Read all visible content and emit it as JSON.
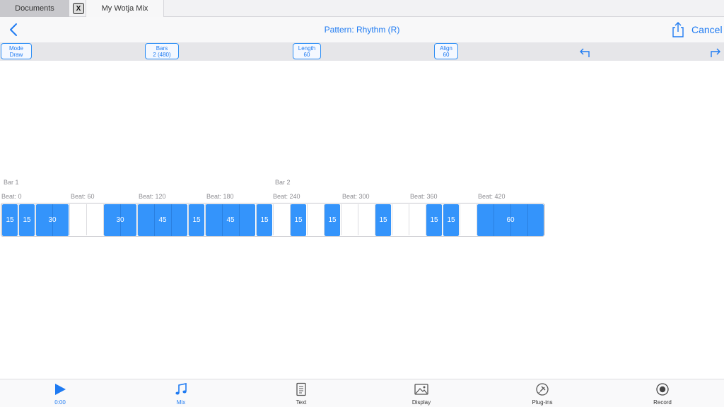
{
  "tabs": {
    "documents": "Documents",
    "close": "X",
    "active": "My Wotja Mix"
  },
  "nav": {
    "title": "Pattern: Rhythm (R)",
    "cancel": "Cancel"
  },
  "toolbar": {
    "mode": {
      "title": "Mode",
      "value": "Draw"
    },
    "bars": {
      "title": "Bars",
      "value": "2 (480)"
    },
    "length": {
      "title": "Length",
      "value": "60"
    },
    "align": {
      "title": "Align",
      "value": "60"
    }
  },
  "timeline": {
    "bars": [
      "Bar 1",
      "Bar 2"
    ],
    "beats": [
      "Beat: 0",
      "Beat: 60",
      "Beat: 120",
      "Beat: 180",
      "Beat: 240",
      "Beat: 300",
      "Beat: 360",
      "Beat: 420"
    ],
    "notes": [
      {
        "start": 0,
        "length": 15,
        "label": "15"
      },
      {
        "start": 15,
        "length": 15,
        "label": "15"
      },
      {
        "start": 30,
        "length": 30,
        "label": "30"
      },
      {
        "start": 90,
        "length": 30,
        "label": "30"
      },
      {
        "start": 120,
        "length": 45,
        "label": "45"
      },
      {
        "start": 165,
        "length": 15,
        "label": "15"
      },
      {
        "start": 180,
        "length": 45,
        "label": "45"
      },
      {
        "start": 225,
        "length": 15,
        "label": "15"
      },
      {
        "start": 255,
        "length": 15,
        "label": "15"
      },
      {
        "start": 285,
        "length": 15,
        "label": "15"
      },
      {
        "start": 330,
        "length": 15,
        "label": "15"
      },
      {
        "start": 375,
        "length": 15,
        "label": "15"
      },
      {
        "start": 390,
        "length": 15,
        "label": "15"
      },
      {
        "start": 420,
        "length": 60,
        "label": "60"
      }
    ]
  },
  "bottom": {
    "play": "0:00",
    "mix": "Mix",
    "text": "Text",
    "display": "Display",
    "plugins": "Plug-ins",
    "record": "Record"
  },
  "colors": {
    "accent": "#1f7bf2",
    "note": "#3494fb"
  }
}
